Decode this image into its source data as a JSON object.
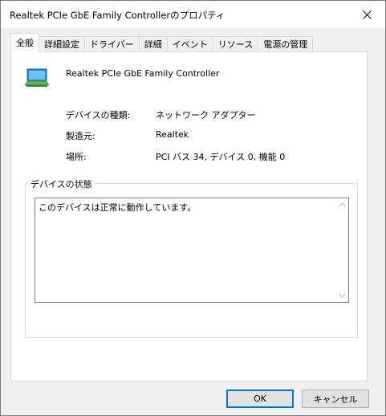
{
  "window": {
    "title": "Realtek PCIe GbE Family Controllerのプロパティ",
    "close_glyph": "✕"
  },
  "tabs": [
    {
      "label": "全般",
      "active": true
    },
    {
      "label": "詳細設定",
      "active": false
    },
    {
      "label": "ドライバー",
      "active": false
    },
    {
      "label": "詳細",
      "active": false
    },
    {
      "label": "イベント",
      "active": false
    },
    {
      "label": "リソース",
      "active": false
    },
    {
      "label": "電源の管理",
      "active": false
    }
  ],
  "device": {
    "icon": "network-adapter-icon",
    "name": "Realtek PCIe GbE Family Controller"
  },
  "properties": [
    {
      "label": "デバイスの種類:",
      "value": "ネットワーク アダプター"
    },
    {
      "label": "製造元:",
      "value": "Realtek"
    },
    {
      "label": "場所:",
      "value": "PCI バス 34, デバイス 0, 機能 0"
    }
  ],
  "status": {
    "group_label": "デバイスの状態",
    "text": "このデバイスは正常に動作しています。"
  },
  "buttons": {
    "ok": "OK",
    "cancel": "キャンセル"
  },
  "colors": {
    "accent": "#0078d7",
    "border": "#7a7a7a"
  }
}
